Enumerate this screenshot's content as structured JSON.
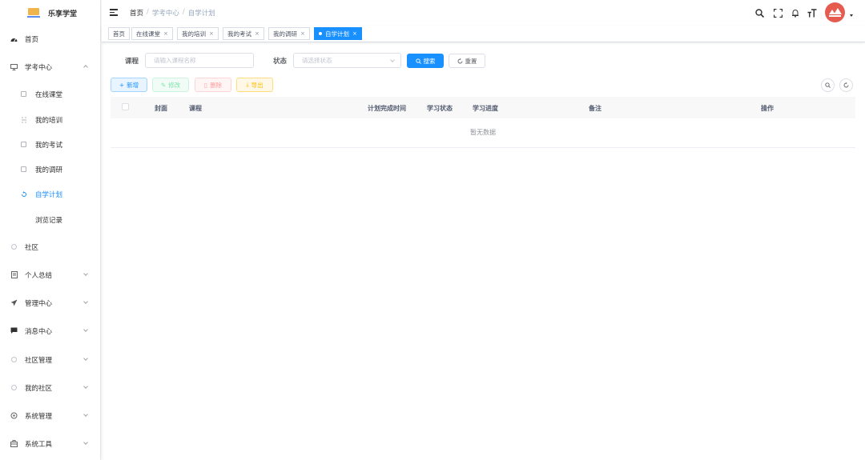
{
  "app": {
    "name": "乐享学堂"
  },
  "sidebar": {
    "items": [
      {
        "label": "首页",
        "icon": "dashboard-icon"
      },
      {
        "label": "学考中心",
        "icon": "monitor-icon",
        "expanded": true
      },
      {
        "label": "在线课堂",
        "icon": "grid-icon"
      },
      {
        "label": "我的培训",
        "icon": "training-icon"
      },
      {
        "label": "我的考试",
        "icon": "exam-icon"
      },
      {
        "label": "我的调研",
        "icon": "survey-icon"
      },
      {
        "label": "自学计划",
        "icon": "plan-icon",
        "active": true
      },
      {
        "label": "浏览记录",
        "icon": ""
      },
      {
        "label": "社区",
        "icon": "community-icon"
      },
      {
        "label": "个人总结",
        "icon": "document-icon"
      },
      {
        "label": "管理中心",
        "icon": "send-icon"
      },
      {
        "label": "消息中心",
        "icon": "message-icon"
      },
      {
        "label": "社区管理",
        "icon": "community-manage-icon"
      },
      {
        "label": "我的社区",
        "icon": "my-community-icon"
      },
      {
        "label": "系统管理",
        "icon": "settings-icon"
      },
      {
        "label": "系统工具",
        "icon": "toolbox-icon"
      }
    ]
  },
  "header": {
    "breadcrumb": [
      "首页",
      "学考中心",
      "自学计划"
    ],
    "separator": "/"
  },
  "tags": [
    {
      "label": "首页",
      "closable": false
    },
    {
      "label": "在线课堂",
      "closable": true
    },
    {
      "label": "我的培训",
      "closable": true
    },
    {
      "label": "我的考试",
      "closable": true
    },
    {
      "label": "我的调研",
      "closable": true
    },
    {
      "label": "自学计划",
      "closable": true,
      "active": true
    }
  ],
  "search": {
    "course_label": "课程",
    "course_placeholder": "请输入课程名称",
    "status_label": "状态",
    "status_placeholder": "请选择状态",
    "search_btn": "搜索",
    "reset_btn": "重置"
  },
  "toolbar": {
    "add": "新增",
    "edit": "修改",
    "delete": "删除",
    "export": "导出"
  },
  "table": {
    "columns": [
      "封面",
      "课程",
      "计划完成时间",
      "学习状态",
      "学习进度",
      "备注",
      "操作"
    ],
    "rows": [],
    "empty_text": "暂无数据"
  },
  "colors": {
    "primary": "#1890ff",
    "avatar": "#e65b4f"
  }
}
